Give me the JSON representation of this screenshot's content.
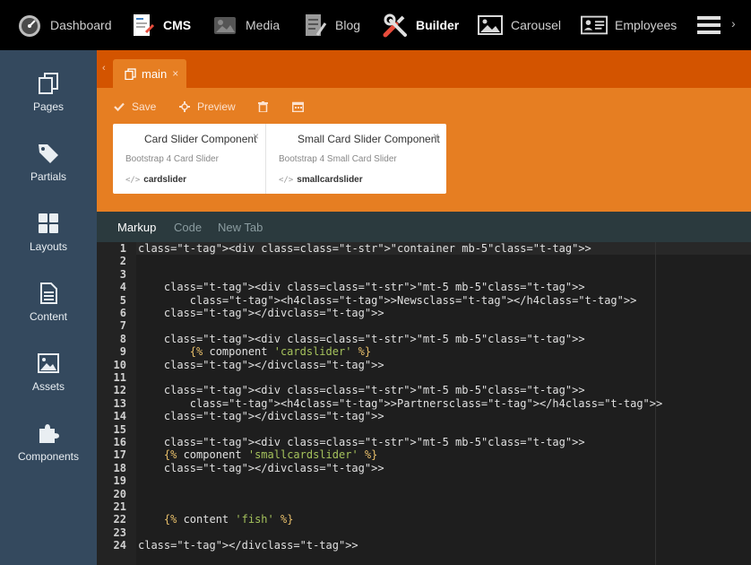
{
  "topnav": {
    "items": [
      {
        "label": "Dashboard",
        "icon": "dashboard-icon"
      },
      {
        "label": "CMS",
        "icon": "cms-icon",
        "active": true
      },
      {
        "label": "Media",
        "icon": "media-icon"
      },
      {
        "label": "Blog",
        "icon": "blog-icon"
      },
      {
        "label": "Builder",
        "icon": "builder-icon",
        "active": true
      },
      {
        "label": "Carousel",
        "icon": "carousel-icon"
      },
      {
        "label": "Employees",
        "icon": "employees-icon"
      }
    ],
    "more_icon": "hamburger-icon",
    "overflow_glyph": "›"
  },
  "sidebar": {
    "items": [
      {
        "label": "Pages",
        "icon": "pages-icon"
      },
      {
        "label": "Partials",
        "icon": "tags-icon"
      },
      {
        "label": "Layouts",
        "icon": "layouts-icon"
      },
      {
        "label": "Content",
        "icon": "content-icon"
      },
      {
        "label": "Assets",
        "icon": "assets-icon"
      },
      {
        "label": "Components",
        "icon": "puzzle-icon"
      }
    ]
  },
  "document_tab": {
    "label": "main",
    "close_glyph": "×",
    "back_glyph": "‹"
  },
  "toolbar": {
    "save_label": "Save",
    "preview_label": "Preview"
  },
  "components": [
    {
      "title": "Card Slider Component",
      "description": "Bootstrap 4 Card Slider",
      "alias": "cardslider",
      "close_glyph": "×"
    },
    {
      "title": "Small Card Slider Component",
      "description": "Bootstrap 4 Small Card Slider",
      "alias": "smallcardslider",
      "close_glyph": "×"
    }
  ],
  "editor_tabs": [
    {
      "label": "Markup",
      "active": true
    },
    {
      "label": "Code"
    },
    {
      "label": "New Tab"
    }
  ],
  "code_lines": [
    "<div class=\"container mb-5\">",
    "",
    "",
    "    <div class=\"mt-5 mb-5\">",
    "        <h4>News</h4>",
    "    </div>",
    "",
    "    <div class=\"mt-5 mb-5\">",
    "        {% component 'cardslider' %}",
    "    </div>",
    "",
    "    <div class=\"mt-5 mb-5\">",
    "        <h4>Partners</h4>",
    "    </div>",
    "",
    "    <div class=\"mt-5 mb-5\">",
    "    {% component 'smallcardslider' %}",
    "    </div>",
    "",
    "",
    "",
    "    {% content 'fish' %}",
    "",
    "</div>"
  ],
  "colors": {
    "accent_dark": "#d35400",
    "accent": "#e67e22",
    "sidebar": "#34495e",
    "topbar": "#000000"
  }
}
